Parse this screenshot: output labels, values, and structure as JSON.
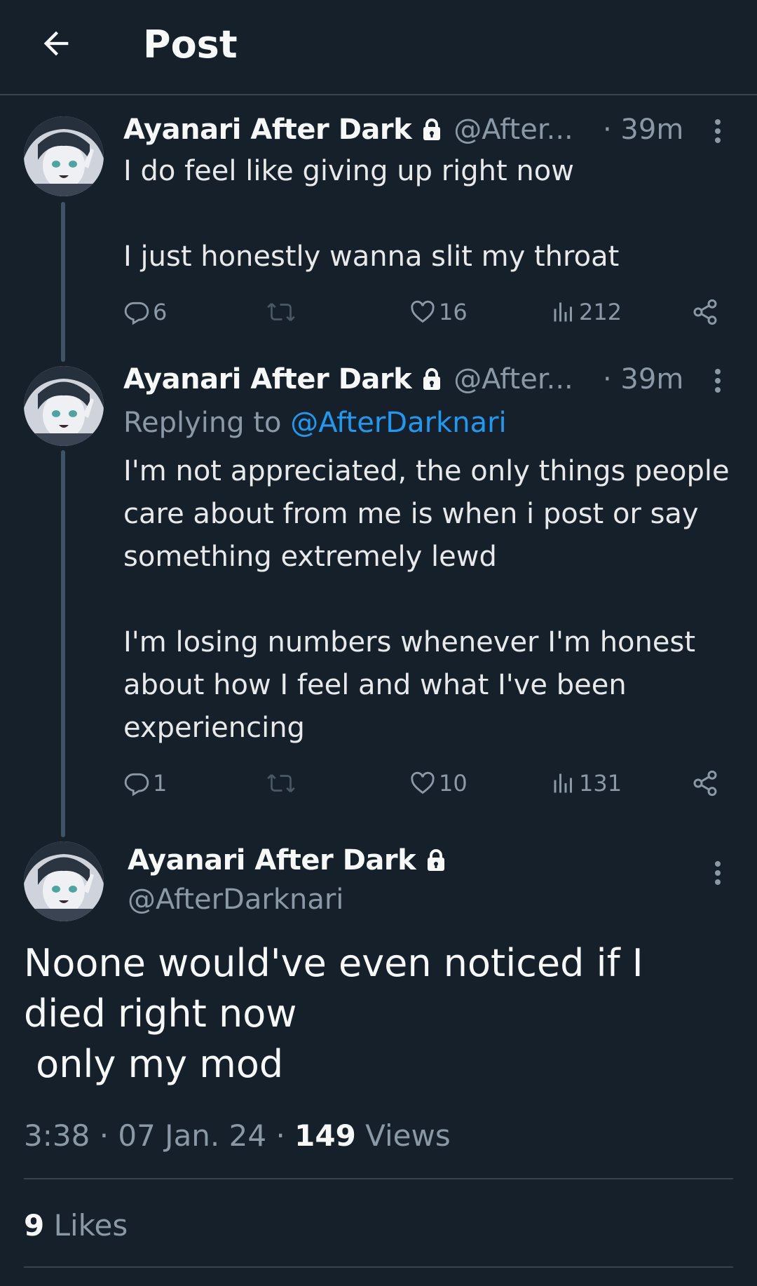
{
  "header": {
    "title": "Post"
  },
  "thread": [
    {
      "name": "Ayanari After Dark",
      "handle": "@After...",
      "time": "· 39m",
      "text": "I do feel like giving up right now\n\nI just honestly wanna slit my throat",
      "stats": {
        "replies": "6",
        "reposts": "",
        "likes": "16",
        "views": "212"
      }
    },
    {
      "name": "Ayanari After Dark",
      "handle": "@After...",
      "time": "· 39m",
      "replying_prefix": "Replying to ",
      "replying_to": "@AfterDarknari",
      "text": "I'm not appreciated, the only things people care about from me is when i post or say something extremely lewd\n\nI'm losing numbers whenever I'm honest about how I feel and what I've been experiencing",
      "stats": {
        "replies": "1",
        "reposts": "",
        "likes": "10",
        "views": "131"
      }
    }
  ],
  "main_post": {
    "name": "Ayanari After Dark",
    "handle": "@AfterDarknari",
    "text": "Noone would've even noticed if I died right now\n only my mod",
    "time": "3:38",
    "date": "07 Jan. 24",
    "views_count": "149",
    "views_label": "Views",
    "likes_count": "9",
    "likes_label": "Likes"
  },
  "colors": {
    "background": "#15202b",
    "text_primary": "#e7e9ea",
    "text_secondary": "#8b98a5",
    "accent": "#1d9bf0",
    "border": "#38444d"
  },
  "icons": [
    "back-arrow-icon",
    "lock-icon",
    "more-vertical-icon",
    "reply-icon",
    "repost-icon",
    "like-icon",
    "views-icon",
    "share-icon"
  ]
}
